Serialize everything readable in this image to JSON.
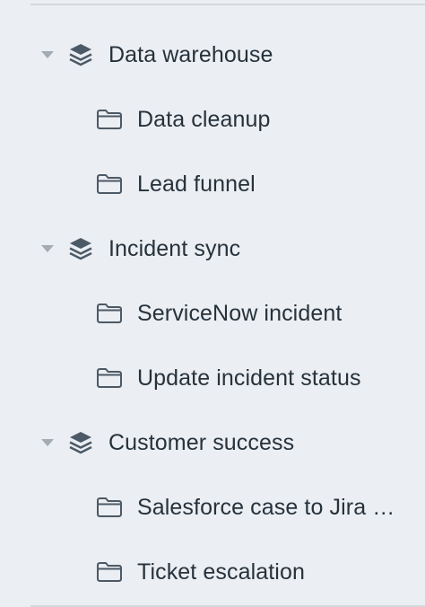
{
  "tree": {
    "groups": [
      {
        "label": "Data warehouse",
        "icon": "layers-icon",
        "expanded": true,
        "children": [
          {
            "label": "Data cleanup",
            "icon": "folder-icon"
          },
          {
            "label": "Lead funnel",
            "icon": "folder-icon"
          }
        ]
      },
      {
        "label": "Incident sync",
        "icon": "layers-icon",
        "expanded": true,
        "children": [
          {
            "label": "ServiceNow incident",
            "icon": "folder-icon"
          },
          {
            "label": "Update incident status",
            "icon": "folder-icon"
          }
        ]
      },
      {
        "label": "Customer success",
        "icon": "layers-icon",
        "expanded": true,
        "children": [
          {
            "label": "Salesforce case to Jira …",
            "icon": "folder-icon"
          },
          {
            "label": "Ticket escalation",
            "icon": "folder-icon"
          }
        ]
      }
    ]
  },
  "colors": {
    "background": "#ebeef2",
    "text": "#26323c",
    "icon": "#4c5966",
    "caret": "#a3abb4",
    "divider": "#d4d8dd"
  }
}
